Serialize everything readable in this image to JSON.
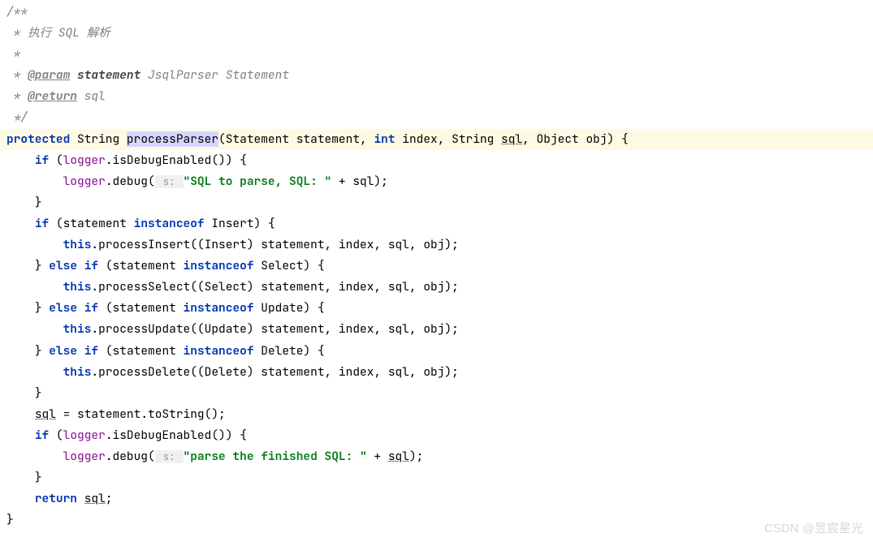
{
  "comment": {
    "line1": "/**",
    "line2": " * 执行 SQL 解析",
    "line3": " *",
    "line4_prefix": " * ",
    "line4_tag": "@param",
    "line4_name": "statement",
    "line4_desc": " JsqlParser Statement",
    "line5_prefix": " * ",
    "line5_tag": "@return",
    "line5_desc": " sql",
    "line6": " */"
  },
  "sig": {
    "kw_protected": "protected",
    "ret_type": " String ",
    "method_name": "processParser",
    "params_1": "(Statement statement, ",
    "kw_int": "int",
    "params_2": " index, String ",
    "param_sql": "sql",
    "params_3": ", Object obj) {"
  },
  "body": {
    "if1_a": "if",
    "if1_b": " (",
    "logger": "logger",
    "if1_c": ".isDebugEnabled()) {",
    "debug1_a": ".debug(",
    "hint_s": " s: ",
    "str1": "\"SQL to parse, SQL: \"",
    "debug1_b": " + sql);",
    "brace_close": "}",
    "if2_a": "if",
    "if2_b": " (statement ",
    "kw_instanceof": "instanceof",
    "if2_c": " Insert) {",
    "this_kw": "this",
    "insert_call": ".processInsert((Insert) statement, index, sql, obj);",
    "else_if": "} ",
    "kw_else": "else",
    "kw_if": "if",
    "elseif_select": " (statement ",
    "elseif_select2": " Select) {",
    "select_call": ".processSelect((Select) statement, index, sql, obj);",
    "elseif_update2": " Update) {",
    "update_call": ".processUpdate((Update) statement, index, sql, obj);",
    "elseif_delete2": " Delete) {",
    "delete_call": ".processDelete((Delete) statement, index, sql, obj);",
    "sql_assign_a": "sql",
    "sql_assign_b": " = statement.toString();",
    "str2": "\"parse the finished SQL: \"",
    "debug2_b": " + ",
    "debug2_c": "sql",
    "debug2_d": ");",
    "kw_return": "return",
    "return_b": " ",
    "return_sql": "sql",
    "return_c": ";"
  },
  "watermark": "CSDN @昱宸星光"
}
